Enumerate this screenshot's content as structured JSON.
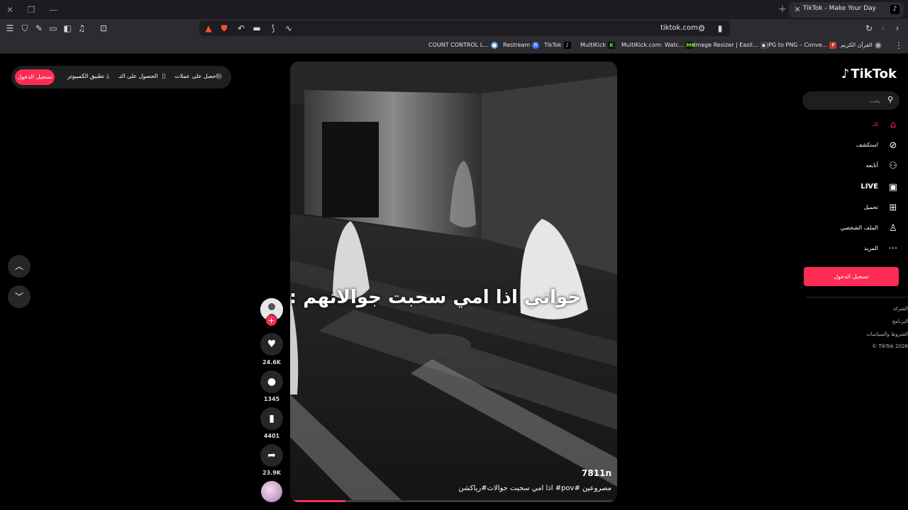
{
  "browser": {
    "tab_title": "TikTok - Make Your Day",
    "tab_icon": "tiktok-icon",
    "url": "tiktok.com",
    "bookmarks": [
      {
        "label": "القرآن الكريم",
        "icon": "globe-icon",
        "color": "#555555"
      },
      {
        "label": "JPG to PNG – Conve...",
        "icon": "png-icon",
        "color": "#c0392b"
      },
      {
        "label": "Image Resizer | Easil...",
        "icon": "square-icon",
        "color": "#444444"
      },
      {
        "label": "MultiKick.com: Watc...",
        "icon": "mk-icon",
        "color": "#53fc18"
      },
      {
        "label": "MultiKick",
        "icon": "k-icon",
        "color": "#53fc18"
      },
      {
        "label": "TikTok",
        "icon": "tiktok-icon",
        "color": "#000000"
      },
      {
        "label": "Restream",
        "icon": "r-icon",
        "color": "#3d6df2"
      },
      {
        "label": "COUNT CONTROL L...",
        "icon": "circle-icon",
        "color": "#5b9bd5"
      }
    ]
  },
  "topbar": {
    "login": "تسجيل الدخول",
    "desktop_app": "تطبيق الكمبيوتر",
    "get_app": "الحصول على التـ",
    "coins": "احصل على عملات"
  },
  "video": {
    "overlay_text": "خواتي اذا امي سحبت جوالاتهم :",
    "views": "7811n",
    "caption": "مصروعين #pov# اذا امي سحبت جوالات#رياكشن",
    "progress": 0.17
  },
  "actions": {
    "likes": "24.6K",
    "comments": "1345",
    "saves": "4401",
    "shares": "23.9K"
  },
  "sidebar": {
    "logo": "TikTok",
    "search_placeholder": "بحث",
    "nav": [
      {
        "label": "لك",
        "icon": "home-icon",
        "active": true
      },
      {
        "label": "استكشف",
        "icon": "compass-icon",
        "active": false
      },
      {
        "label": "أتابعه",
        "icon": "user-plus-icon",
        "active": false
      },
      {
        "label": "LIVE",
        "icon": "tv-icon",
        "active": false
      },
      {
        "label": "تحميل",
        "icon": "upload-plus-icon",
        "active": false
      },
      {
        "label": "الملف الشخصي",
        "icon": "person-icon",
        "active": false
      },
      {
        "label": "المزيد",
        "icon": "more-icon",
        "active": false
      }
    ],
    "login": "تسجيل الدخول",
    "footer": [
      "الشركة",
      "البرنامج",
      "الشروط والسياسات",
      "© TikTok 2026"
    ]
  },
  "colors": {
    "accent": "#fe2c55",
    "background": "#000000",
    "chrome": "#2b2b30"
  }
}
